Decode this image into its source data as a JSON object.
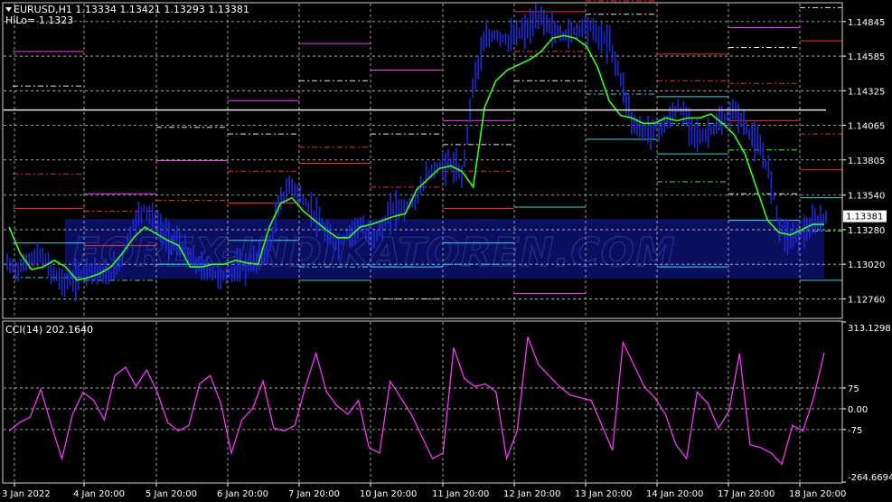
{
  "header": {
    "symbol_line": "EURUSD,H1  1.13334 1.13421 1.13293 1.13381",
    "hilo_line": "HiLo= 1.1323"
  },
  "watermark": "FOREX-INDIKATOREN.COM",
  "colors": {
    "background": "#000000",
    "grid": "#c8c8c8",
    "price_bars": "#1f2bd6",
    "hilo_line": "#33ff1a",
    "cci_line": "#ff33ff",
    "hline_white": "#e6e6e6",
    "watermark_band": "#0d1270"
  },
  "chart_data": [
    {
      "type": "bar",
      "title": "EURUSD,H1  1.13334 1.13421 1.13293 1.13381",
      "ylim": [
        1.1262,
        1.1498
      ],
      "y_ticks": [
        "1.14845",
        "1.14585",
        "1.14325",
        "1.14065",
        "1.13805",
        "1.13540",
        "1.13280",
        "1.13020",
        "1.12760"
      ],
      "y_tick_values": [
        1.14845,
        1.14585,
        1.14325,
        1.14065,
        1.13805,
        1.1354,
        1.1328,
        1.1302,
        1.1276
      ],
      "current_price_label": "1.13381",
      "current_price": 1.13381,
      "white_level": 1.1418,
      "x_ticks": [
        "3 Jan 2022",
        "4 Jan 20:00",
        "5 Jan 20:00",
        "6 Jan 20:00",
        "7 Jan 20:00",
        "10 Jan 20:00",
        "11 Jan 20:00",
        "12 Jan 20:00",
        "13 Jan 20:00",
        "14 Jan 20:00",
        "17 Jan 20:00",
        "18 Jan 20:00"
      ],
      "price_series": [
        1.1302,
        1.1298,
        1.1306,
        1.1308,
        1.1296,
        1.1288,
        1.129,
        1.13,
        1.1296,
        1.1292,
        1.1305,
        1.133,
        1.1345,
        1.1335,
        1.1322,
        1.1318,
        1.1308,
        1.13,
        1.1296,
        1.1292,
        1.1298,
        1.13,
        1.1306,
        1.1312,
        1.135,
        1.1362,
        1.135,
        1.134,
        1.1325,
        1.1316,
        1.1325,
        1.1332,
        1.132,
        1.133,
        1.1345,
        1.1344,
        1.1352,
        1.137,
        1.1376,
        1.1378,
        1.1368,
        1.144,
        1.147,
        1.1475,
        1.147,
        1.1476,
        1.148,
        1.1488,
        1.1478,
        1.1474,
        1.1478,
        1.1482,
        1.1474,
        1.1468,
        1.144,
        1.1408,
        1.1402,
        1.1404,
        1.1408,
        1.142,
        1.1408,
        1.1396,
        1.1404,
        1.141,
        1.1418,
        1.1404,
        1.1392,
        1.1372,
        1.1328,
        1.1322,
        1.1326,
        1.1332,
        1.1338
      ],
      "hilo_series": [
        1.133,
        1.131,
        1.1298,
        1.13,
        1.1305,
        1.13,
        1.129,
        1.1292,
        1.1295,
        1.13,
        1.131,
        1.1322,
        1.133,
        1.1325,
        1.132,
        1.1316,
        1.13,
        1.13,
        1.1302,
        1.1302,
        1.1305,
        1.1303,
        1.1302,
        1.133,
        1.1348,
        1.1352,
        1.1342,
        1.1335,
        1.1328,
        1.1322,
        1.1322,
        1.133,
        1.1332,
        1.1335,
        1.1338,
        1.134,
        1.1358,
        1.1366,
        1.1374,
        1.1376,
        1.1372,
        1.136,
        1.142,
        1.144,
        1.1448,
        1.1452,
        1.1456,
        1.1462,
        1.1472,
        1.1474,
        1.1472,
        1.1466,
        1.145,
        1.1425,
        1.1414,
        1.1412,
        1.1408,
        1.1408,
        1.1412,
        1.141,
        1.1412,
        1.1412,
        1.1415,
        1.1408,
        1.14,
        1.1385,
        1.136,
        1.1335,
        1.1326,
        1.1324,
        1.1328,
        1.1332,
        1.1332
      ],
      "level_lines": [
        {
          "y": 1.1462,
          "x0": 14,
          "x1": 93,
          "c": "#ff33ff",
          "d": "solid"
        },
        {
          "y": 1.1436,
          "x0": 14,
          "x1": 93,
          "c": "#e6e6e6",
          "d": "dash"
        },
        {
          "y": 1.137,
          "x0": 14,
          "x1": 93,
          "c": "#ff2b2b",
          "d": "dash"
        },
        {
          "y": 1.1344,
          "x0": 14,
          "x1": 93,
          "c": "#ff2b2b",
          "d": "solid"
        },
        {
          "y": 1.1318,
          "x0": 14,
          "x1": 93,
          "c": "#37d7e8",
          "d": "solid"
        },
        {
          "y": 1.1292,
          "x0": 14,
          "x1": 93,
          "c": "#37d7e8",
          "d": "dash"
        },
        {
          "y": 1.1355,
          "x0": 93,
          "x1": 173,
          "c": "#ff33ff",
          "d": "solid"
        },
        {
          "y": 1.1342,
          "x0": 93,
          "x1": 173,
          "c": "#ff2b2b",
          "d": "dash"
        },
        {
          "y": 1.1316,
          "x0": 93,
          "x1": 173,
          "c": "#ff2b2b",
          "d": "solid"
        },
        {
          "y": 1.129,
          "x0": 93,
          "x1": 173,
          "c": "#37d7e8",
          "d": "dash"
        },
        {
          "y": 1.1405,
          "x0": 173,
          "x1": 252,
          "c": "#e6e6e6",
          "d": "dash"
        },
        {
          "y": 1.138,
          "x0": 173,
          "x1": 252,
          "c": "#ff33ff",
          "d": "solid"
        },
        {
          "y": 1.135,
          "x0": 173,
          "x1": 252,
          "c": "#ff2b2b",
          "d": "dash"
        },
        {
          "y": 1.1302,
          "x0": 173,
          "x1": 252,
          "c": "#37d7e8",
          "d": "solid"
        },
        {
          "y": 1.1425,
          "x0": 252,
          "x1": 331,
          "c": "#ff33ff",
          "d": "solid"
        },
        {
          "y": 1.14,
          "x0": 252,
          "x1": 331,
          "c": "#e6e6e6",
          "d": "dash"
        },
        {
          "y": 1.1372,
          "x0": 252,
          "x1": 331,
          "c": "#ff2b2b",
          "d": "dash"
        },
        {
          "y": 1.1348,
          "x0": 252,
          "x1": 331,
          "c": "#ff2b2b",
          "d": "solid"
        },
        {
          "y": 1.132,
          "x0": 252,
          "x1": 331,
          "c": "#37d7e8",
          "d": "solid"
        },
        {
          "y": 1.1468,
          "x0": 331,
          "x1": 410,
          "c": "#ff33ff",
          "d": "solid"
        },
        {
          "y": 1.144,
          "x0": 331,
          "x1": 410,
          "c": "#e6e6e6",
          "d": "dash"
        },
        {
          "y": 1.139,
          "x0": 331,
          "x1": 410,
          "c": "#ff2b2b",
          "d": "dash"
        },
        {
          "y": 1.1378,
          "x0": 331,
          "x1": 410,
          "c": "#ff2b2b",
          "d": "solid"
        },
        {
          "y": 1.13,
          "x0": 331,
          "x1": 410,
          "c": "#37d7e8",
          "d": "dash"
        },
        {
          "y": 1.129,
          "x0": 331,
          "x1": 410,
          "c": "#37d7e8",
          "d": "solid"
        },
        {
          "y": 1.1448,
          "x0": 410,
          "x1": 490,
          "c": "#ff33ff",
          "d": "solid"
        },
        {
          "y": 1.14,
          "x0": 410,
          "x1": 490,
          "c": "#e6e6e6",
          "d": "dash"
        },
        {
          "y": 1.136,
          "x0": 410,
          "x1": 490,
          "c": "#ff2b2b",
          "d": "dash"
        },
        {
          "y": 1.13,
          "x0": 410,
          "x1": 490,
          "c": "#37d7e8",
          "d": "solid"
        },
        {
          "y": 1.1276,
          "x0": 410,
          "x1": 490,
          "c": "#e6e6e6",
          "d": "dash"
        },
        {
          "y": 1.141,
          "x0": 490,
          "x1": 569,
          "c": "#ff33ff",
          "d": "solid"
        },
        {
          "y": 1.1392,
          "x0": 490,
          "x1": 569,
          "c": "#e6e6e6",
          "d": "dash"
        },
        {
          "y": 1.1372,
          "x0": 490,
          "x1": 569,
          "c": "#ff2b2b",
          "d": "dash"
        },
        {
          "y": 1.1344,
          "x0": 490,
          "x1": 569,
          "c": "#ff2b2b",
          "d": "solid"
        },
        {
          "y": 1.1318,
          "x0": 490,
          "x1": 569,
          "c": "#37d7e8",
          "d": "solid"
        },
        {
          "y": 1.1302,
          "x0": 490,
          "x1": 569,
          "c": "#37d7e8",
          "d": "dash"
        },
        {
          "y": 1.1492,
          "x0": 569,
          "x1": 648,
          "c": "#ff2b2b",
          "d": "solid"
        },
        {
          "y": 1.1462,
          "x0": 569,
          "x1": 648,
          "c": "#ff2b2b",
          "d": "dash"
        },
        {
          "y": 1.144,
          "x0": 569,
          "x1": 648,
          "c": "#e6e6e6",
          "d": "dash"
        },
        {
          "y": 1.1345,
          "x0": 569,
          "x1": 648,
          "c": "#37d7e8",
          "d": "solid"
        },
        {
          "y": 1.128,
          "x0": 569,
          "x1": 648,
          "c": "#ff33ff",
          "d": "solid"
        },
        {
          "y": 1.15,
          "x0": 648,
          "x1": 727,
          "c": "#ff2b2b",
          "d": "dash"
        },
        {
          "y": 1.149,
          "x0": 648,
          "x1": 727,
          "c": "#e6e6e6",
          "d": "dash"
        },
        {
          "y": 1.143,
          "x0": 648,
          "x1": 727,
          "c": "#37d7e8",
          "d": "dash"
        },
        {
          "y": 1.1396,
          "x0": 648,
          "x1": 727,
          "c": "#37d7e8",
          "d": "solid"
        },
        {
          "y": 1.146,
          "x0": 727,
          "x1": 806,
          "c": "#ff2b2b",
          "d": "solid"
        },
        {
          "y": 1.144,
          "x0": 727,
          "x1": 806,
          "c": "#ff2b2b",
          "d": "dash"
        },
        {
          "y": 1.1428,
          "x0": 727,
          "x1": 806,
          "c": "#37d7e8",
          "d": "solid"
        },
        {
          "y": 1.1408,
          "x0": 727,
          "x1": 806,
          "c": "#37d7e8",
          "d": "dash"
        },
        {
          "y": 1.1385,
          "x0": 727,
          "x1": 806,
          "c": "#37d7e8",
          "d": "solid"
        },
        {
          "y": 1.1364,
          "x0": 727,
          "x1": 806,
          "c": "#33ff1a",
          "d": "dash"
        },
        {
          "y": 1.13,
          "x0": 727,
          "x1": 806,
          "c": "#37d7e8",
          "d": "solid"
        },
        {
          "y": 1.148,
          "x0": 806,
          "x1": 885,
          "c": "#ff33ff",
          "d": "solid"
        },
        {
          "y": 1.1465,
          "x0": 806,
          "x1": 885,
          "c": "#e6e6e6",
          "d": "dash"
        },
        {
          "y": 1.1438,
          "x0": 806,
          "x1": 885,
          "c": "#ff2b2b",
          "d": "dash"
        },
        {
          "y": 1.141,
          "x0": 806,
          "x1": 885,
          "c": "#ff2b2b",
          "d": "solid"
        },
        {
          "y": 1.1388,
          "x0": 806,
          "x1": 885,
          "c": "#33ff1a",
          "d": "dash"
        },
        {
          "y": 1.1355,
          "x0": 806,
          "x1": 885,
          "c": "#e6e6e6",
          "d": "dash"
        },
        {
          "y": 1.1335,
          "x0": 806,
          "x1": 885,
          "c": "#37d7e8",
          "d": "solid"
        },
        {
          "y": 1.1495,
          "x0": 885,
          "x1": 932,
          "c": "#e6e6e6",
          "d": "dash"
        },
        {
          "y": 1.147,
          "x0": 885,
          "x1": 932,
          "c": "#ff2b2b",
          "d": "solid"
        },
        {
          "y": 1.14,
          "x0": 885,
          "x1": 932,
          "c": "#ff2b2b",
          "d": "dash"
        },
        {
          "y": 1.1373,
          "x0": 885,
          "x1": 932,
          "c": "#ff2b2b",
          "d": "solid"
        },
        {
          "y": 1.1352,
          "x0": 885,
          "x1": 932,
          "c": "#37d7e8",
          "d": "solid"
        },
        {
          "y": 1.1327,
          "x0": 885,
          "x1": 932,
          "c": "#33ff1a",
          "d": "dash"
        },
        {
          "y": 1.129,
          "x0": 885,
          "x1": 932,
          "c": "#37d7e8",
          "d": "solid"
        }
      ]
    },
    {
      "type": "line",
      "title": "CCI(14) 202.1640",
      "ylim": [
        -264.6694,
        313.1298
      ],
      "y_ticks": [
        "313.1298",
        "75",
        "0.00",
        "-75",
        "-264.6694"
      ],
      "y_tick_values": [
        313.1298,
        75,
        0,
        -75,
        -264.6694
      ],
      "levels": [
        75,
        0,
        -75
      ],
      "values": [
        -80,
        -50,
        -30,
        70,
        -60,
        -180,
        -20,
        60,
        30,
        -40,
        120,
        150,
        80,
        140,
        60,
        -50,
        -80,
        -60,
        90,
        120,
        20,
        -160,
        -40,
        0,
        100,
        -70,
        -80,
        -60,
        80,
        200,
        60,
        10,
        -20,
        30,
        -140,
        -160,
        100,
        40,
        -20,
        -100,
        -180,
        -160,
        220,
        110,
        80,
        90,
        60,
        -180,
        -80,
        260,
        160,
        120,
        80,
        50,
        40,
        30,
        -60,
        -150,
        240,
        160,
        80,
        40,
        -20,
        -130,
        -180,
        60,
        20,
        -70,
        -10,
        200,
        -130,
        -140,
        -160,
        -200,
        -60,
        -80,
        40,
        202
      ]
    }
  ]
}
